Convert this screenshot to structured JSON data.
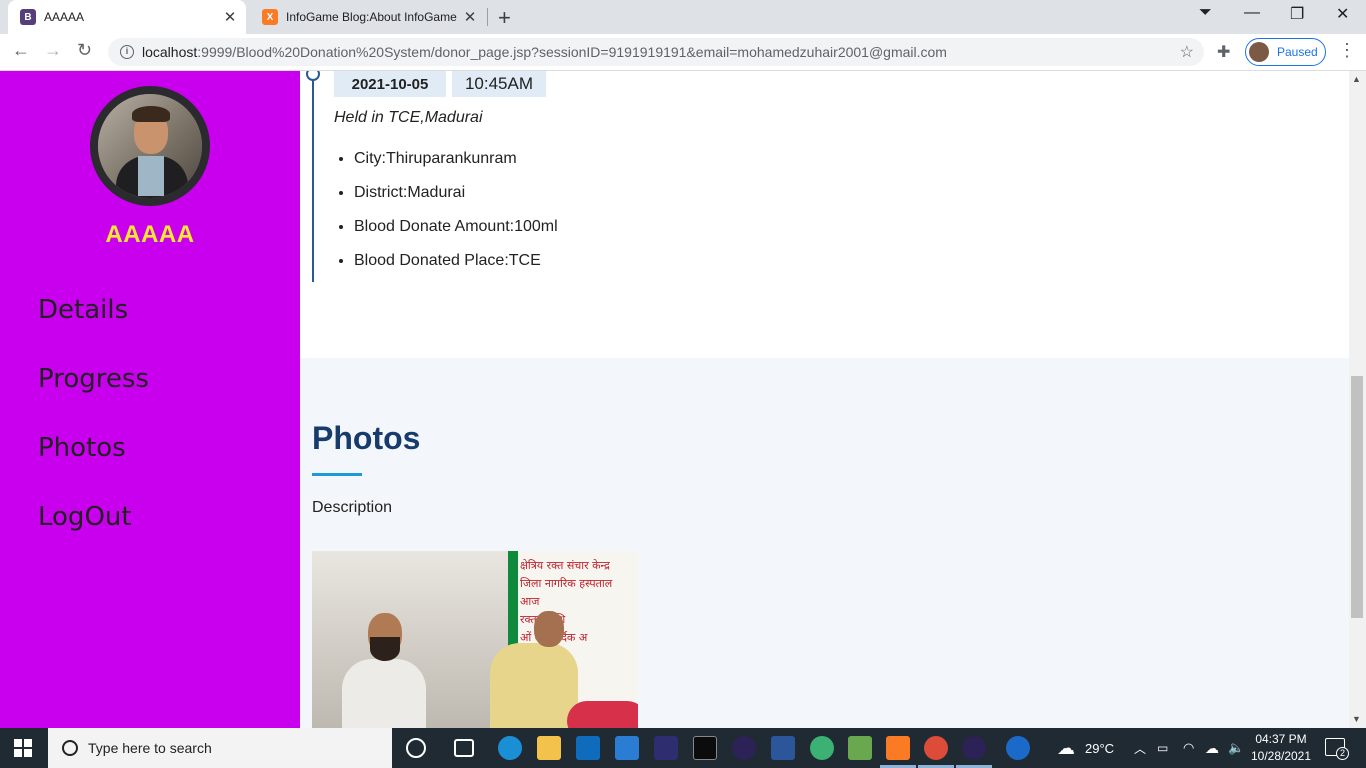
{
  "browser": {
    "tabs": [
      {
        "label": "AAAAA",
        "favicon": "B"
      },
      {
        "label": "InfoGame Blog:About InfoGame",
        "favicon": "X"
      }
    ],
    "url_host": "localhost",
    "url_rest": ":9999/Blood%20Donation%20System/donor_page.jsp?sessionID=9191919191&email=mohamedzuhair2001@gmail.com",
    "profile_status": "Paused"
  },
  "sidebar": {
    "username": "AAAAA",
    "nav": [
      {
        "label": "Details"
      },
      {
        "label": "Progress"
      },
      {
        "label": "Photos"
      },
      {
        "label": "LogOut"
      }
    ]
  },
  "timeline": {
    "date": "2021-10-05",
    "time": "10:45AM",
    "held": "Held in TCE,Madurai",
    "details": [
      "City:Thiruparankunram",
      "District:Madurai",
      "Blood Donate Amount:100ml",
      "Blood Donated Place:TCE"
    ]
  },
  "photos": {
    "title": "Photos",
    "description": "Description",
    "banner_text": [
      "क्षेत्रिय रक्त संचार केन्द्र",
      "जिला नागरिक हस्पताल",
      "आज",
      "रक्तदान शि",
      "ओं का हार्दिक अ"
    ]
  },
  "taskbar": {
    "search_placeholder": "Type here to search",
    "weather": "29°C",
    "time": "04:37 PM",
    "date": "10/28/2021",
    "notifications": "2"
  },
  "colors": {
    "sidebar_bg": "#c800ee",
    "username": "#ffe930",
    "heading": "#173b6a",
    "accent": "#1e9bd7"
  }
}
